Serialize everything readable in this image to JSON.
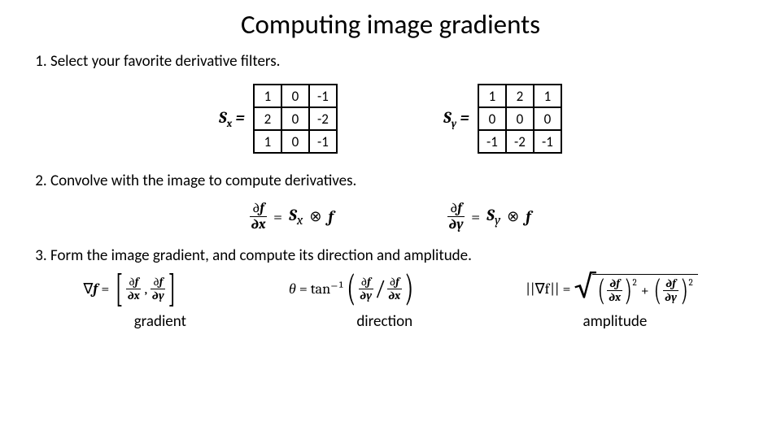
{
  "title": "Computing image gradients",
  "steps": {
    "s1": "Select your favorite derivative filters.",
    "s2": "Convolve with the image to compute derivatives.",
    "s3": "Form the image gradient, and compute its direction and amplitude."
  },
  "filter_x_label": "S",
  "filter_x_sub": "x",
  "filter_y_label": "S",
  "filter_y_sub": "y",
  "eq_sign": " = ",
  "Sx": [
    [
      "1",
      "0",
      "-1"
    ],
    [
      "2",
      "0",
      "-2"
    ],
    [
      "1",
      "0",
      "-1"
    ]
  ],
  "Sy": [
    [
      "1",
      "2",
      "1"
    ],
    [
      "0",
      "0",
      "0"
    ],
    [
      "-1",
      "-2",
      "-1"
    ]
  ],
  "convolve": {
    "lhs_df": "∂f",
    "lhs_dx": "∂x",
    "lhs_dy": "∂y",
    "rhs_Sx": "S",
    "rhs_Sx_sub": "x",
    "rhs_Sy": "S",
    "rhs_Sy_sub": "y",
    "otimes": "⊗",
    "f": "f"
  },
  "gradient": {
    "nabla_f": "∇f",
    "theta": "θ",
    "atan": "tan⁻¹",
    "norm_lhs": "||∇f|| ="
  },
  "labels": {
    "gradient": "gradient",
    "direction": "direction",
    "amplitude": "amplitude"
  }
}
